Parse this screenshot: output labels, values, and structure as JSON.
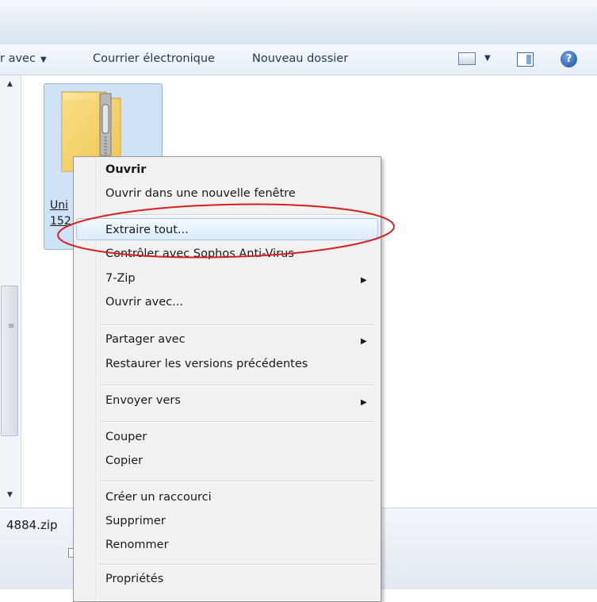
{
  "toolbar": {
    "open_with_partial": "r avec",
    "email": "Courrier électronique",
    "new_folder": "Nouveau dossier",
    "help_glyph": "?"
  },
  "file": {
    "name_line1": "Uni",
    "name_line2": "152",
    "status_name": "4884.zip"
  },
  "context_menu": {
    "open": "Ouvrir",
    "open_new_window": "Ouvrir dans une nouvelle fenêtre",
    "extract_all": "Extraire tout...",
    "sophos": "Contrôler avec Sophos Anti-Virus",
    "seven_zip": "7-Zip",
    "open_with": "Ouvrir avec...",
    "share_with": "Partager avec",
    "restore_versions": "Restaurer les versions précédentes",
    "send_to": "Envoyer vers",
    "cut": "Couper",
    "copy": "Copier",
    "create_shortcut": "Créer un raccourci",
    "delete": "Supprimer",
    "rename": "Renommer",
    "properties": "Propriétés"
  },
  "colors": {
    "highlight_ellipse": "#d6201f",
    "selection_bg": "#cfe2f7",
    "toolbar_text": "#1e395b"
  },
  "icons": [
    "dropdown-arrow-icon",
    "views-icon",
    "preview-pane-icon",
    "help-icon",
    "zip-folder-icon",
    "submenu-arrow-icon",
    "scroll-up-icon",
    "scroll-down-icon"
  ]
}
